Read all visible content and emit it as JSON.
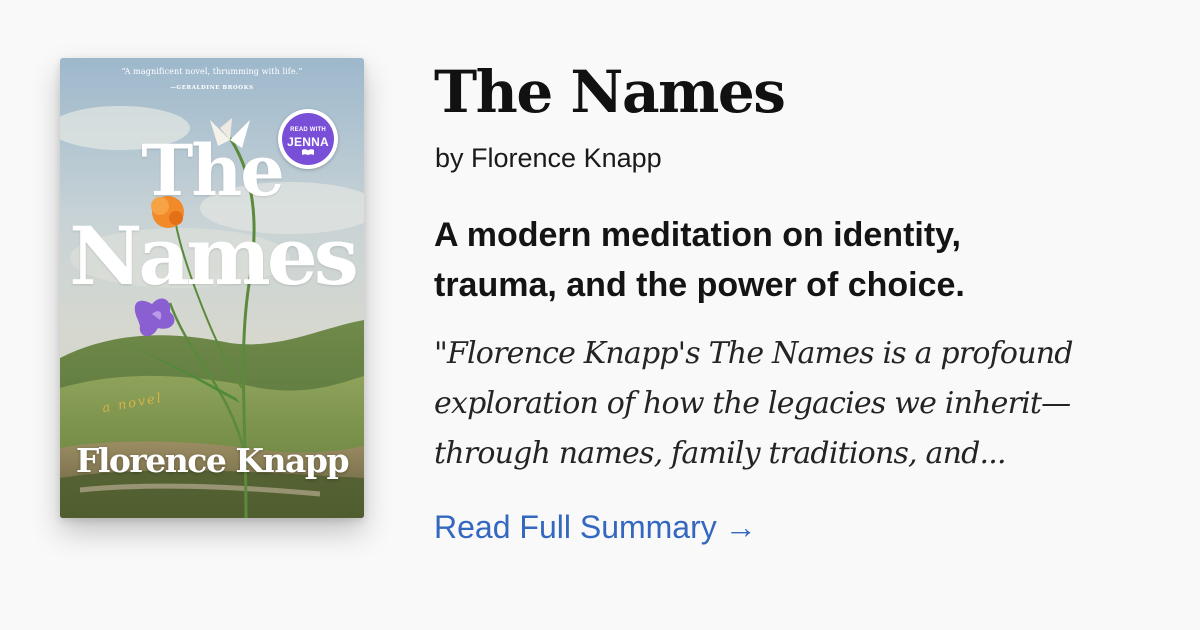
{
  "cover": {
    "blurb": "“A magnificent novel, thrumming with life.”",
    "blurb_attribution": "—GERALDINE BROOKS",
    "title_line1": "The",
    "title_line2": "Names",
    "subtitle": "a novel",
    "author": "Florence Knapp",
    "badge": {
      "line1": "READ WITH",
      "line2": "JENNA",
      "color": "#7a4fd8"
    }
  },
  "book": {
    "title": "The Names",
    "byline": "by Florence Knapp",
    "tagline_lines": [
      "A modern meditation on identity,",
      "trauma, and the power of choice."
    ],
    "excerpt_lines": [
      "\"Florence Knapp's The Names is a profound",
      "exploration of how the legacies we inherit—",
      "through names, family traditions, and..."
    ]
  },
  "cta": {
    "label": "Read Full Summary",
    "arrow": "→",
    "color": "#3468c0"
  },
  "colors": {
    "background": "#f9f9f9",
    "text": "#111111"
  }
}
